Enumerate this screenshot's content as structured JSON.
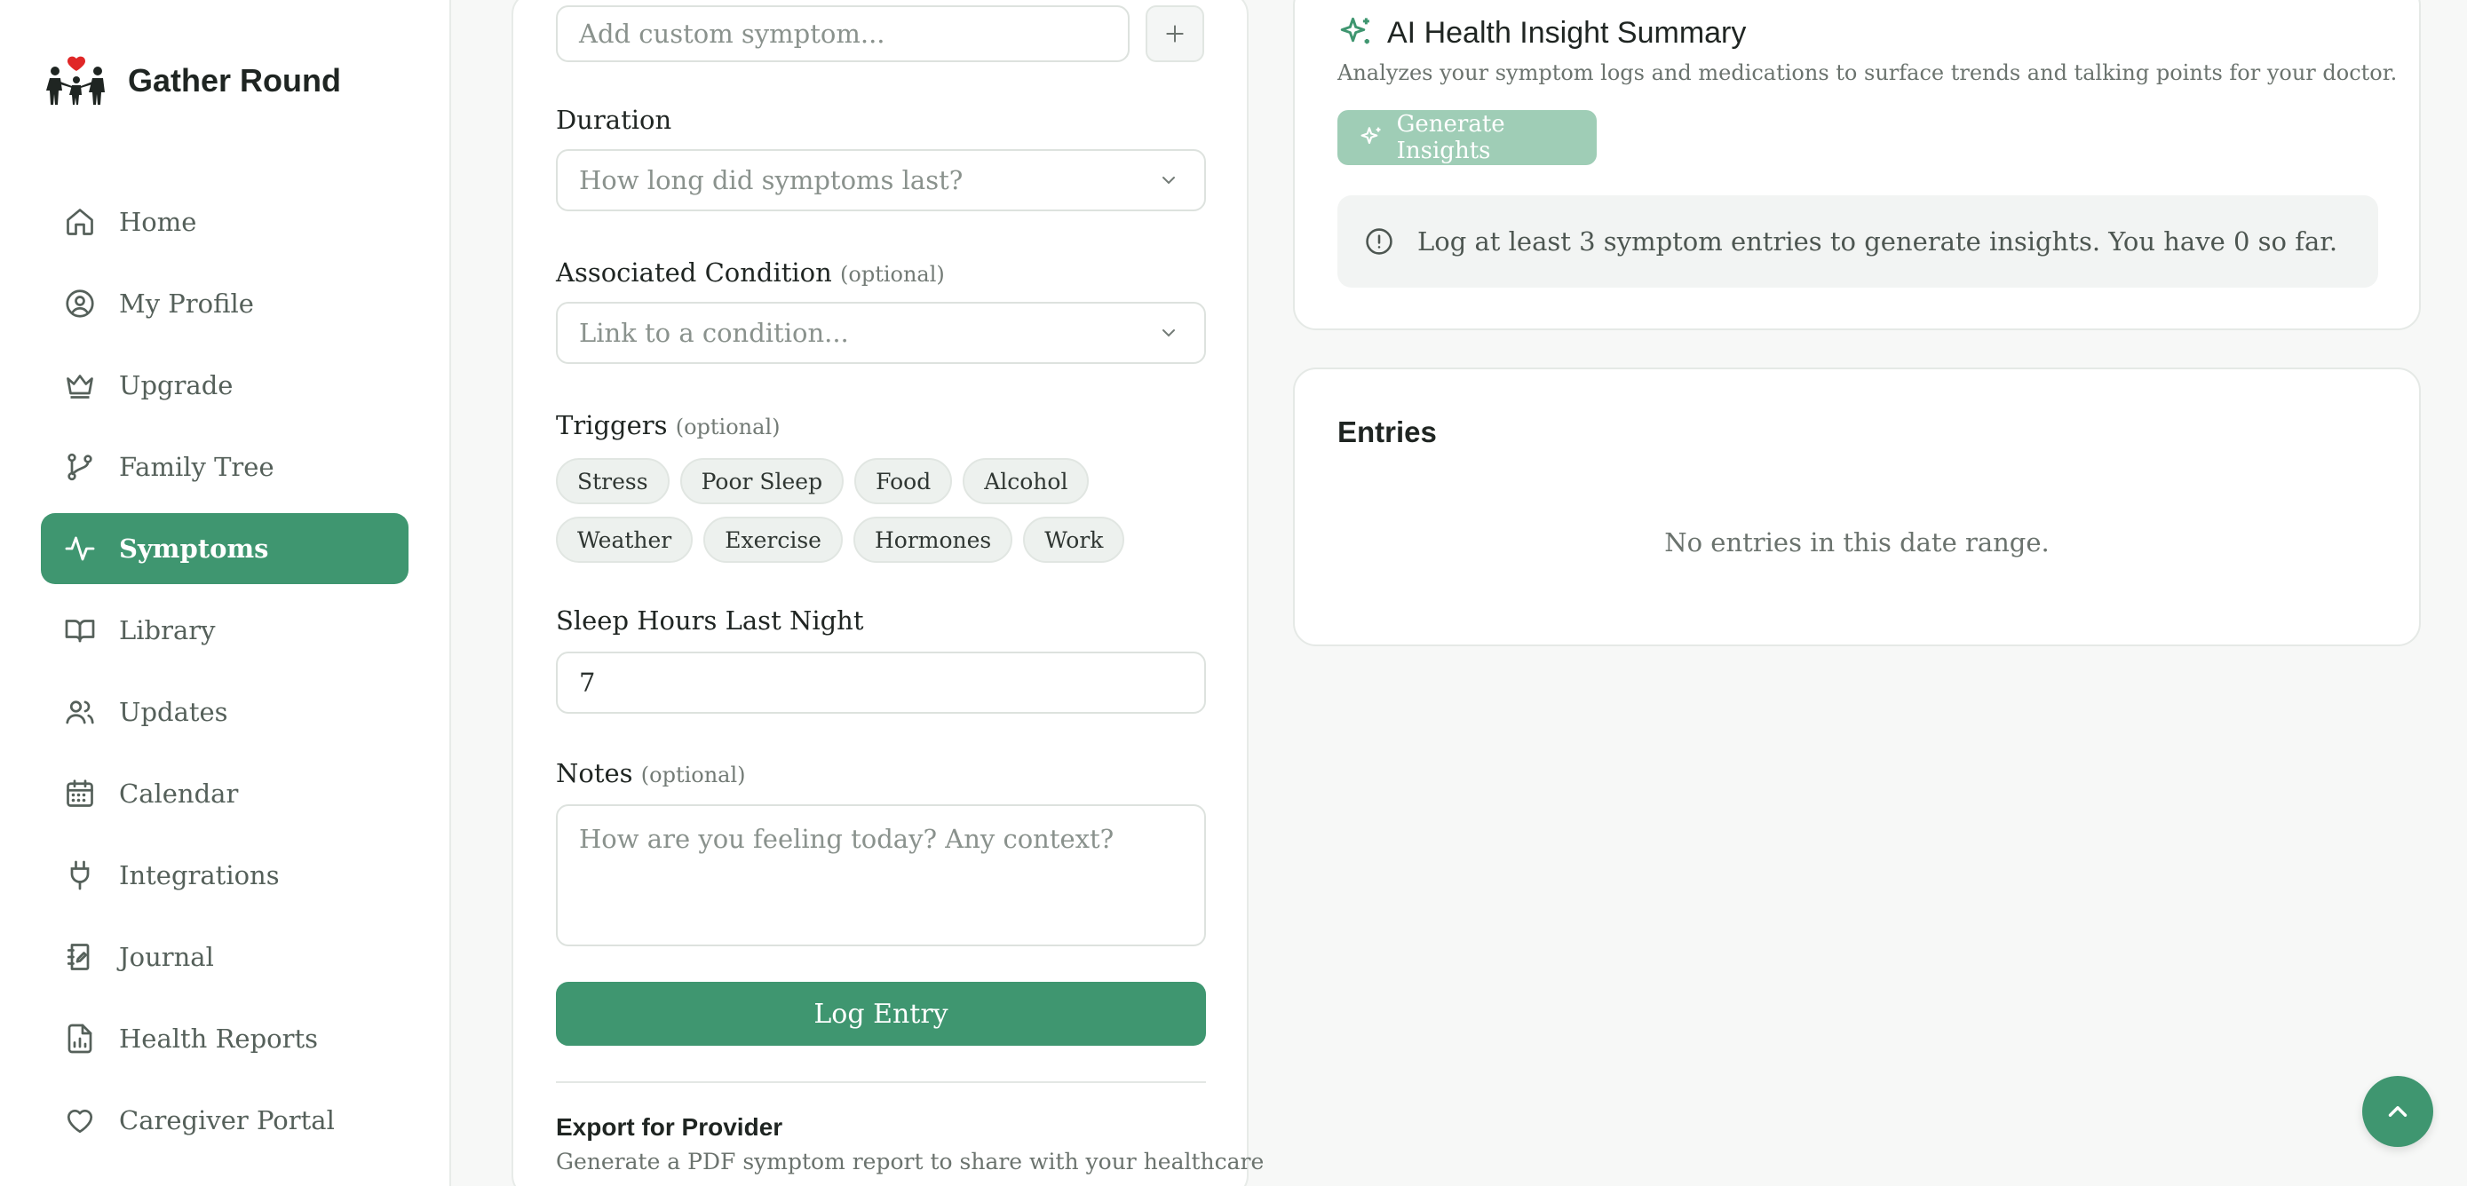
{
  "brand": {
    "title": "Gather Round",
    "logo_icon": "family-heart-icon"
  },
  "sidebar": {
    "items": [
      {
        "label": "Home",
        "icon": "home-icon",
        "active": false
      },
      {
        "label": "My Profile",
        "icon": "user-circle-icon",
        "active": false
      },
      {
        "label": "Upgrade",
        "icon": "crown-icon",
        "active": false
      },
      {
        "label": "Family Tree",
        "icon": "git-branch-icon",
        "active": false
      },
      {
        "label": "Symptoms",
        "icon": "activity-icon",
        "active": true
      },
      {
        "label": "Library",
        "icon": "book-open-icon",
        "active": false
      },
      {
        "label": "Updates",
        "icon": "users-icon",
        "active": false
      },
      {
        "label": "Calendar",
        "icon": "calendar-icon",
        "active": false
      },
      {
        "label": "Integrations",
        "icon": "plug-icon",
        "active": false
      },
      {
        "label": "Journal",
        "icon": "notebook-icon",
        "active": false
      },
      {
        "label": "Health Reports",
        "icon": "file-chart-icon",
        "active": false
      },
      {
        "label": "Caregiver Portal",
        "icon": "heart-icon",
        "active": false
      }
    ]
  },
  "form": {
    "custom_symptom_placeholder": "Add custom symptom...",
    "duration": {
      "label": "Duration",
      "placeholder": "How long did symptoms last?"
    },
    "condition": {
      "label": "Associated Condition",
      "optional": "(optional)",
      "placeholder": "Link to a condition..."
    },
    "triggers": {
      "label": "Triggers",
      "optional": "(optional)",
      "items": [
        "Stress",
        "Poor Sleep",
        "Food",
        "Alcohol",
        "Weather",
        "Exercise",
        "Hormones",
        "Work"
      ]
    },
    "sleep": {
      "label": "Sleep Hours Last Night",
      "value": "7"
    },
    "notes": {
      "label": "Notes",
      "optional": "(optional)",
      "placeholder": "How are you feeling today? Any context?"
    },
    "submit_label": "Log Entry",
    "export": {
      "title": "Export for Provider",
      "description": "Generate a PDF symptom report to share with your healthcare"
    }
  },
  "insight": {
    "title": "AI Health Insight Summary",
    "description": "Analyzes your symptom logs and medications to surface trends and talking points for your doctor.",
    "button_label": "Generate Insights",
    "notice": "Log at least 3 symptom entries to generate insights. You have 0 so far."
  },
  "entries": {
    "title": "Entries",
    "empty": "No entries in this date range."
  },
  "colors": {
    "accent": "#3f9670",
    "accent_disabled": "#9fcdb6"
  }
}
